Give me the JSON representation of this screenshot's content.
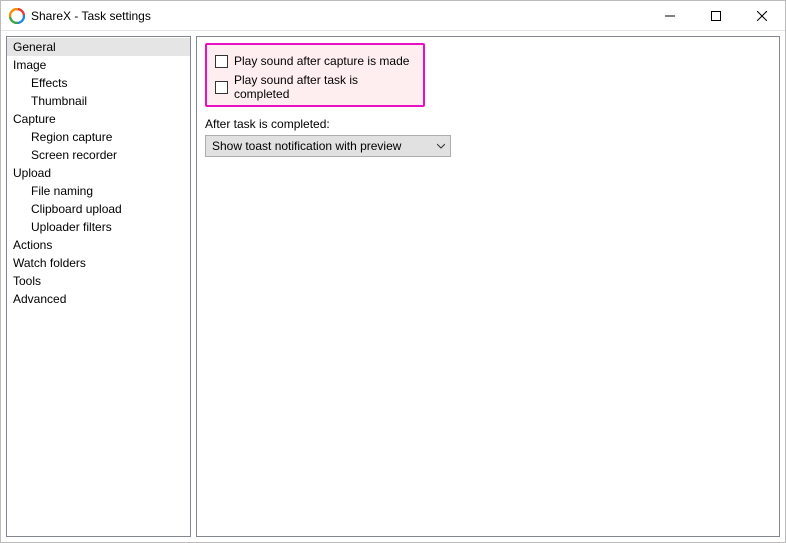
{
  "window": {
    "title": "ShareX - Task settings"
  },
  "sidebar": {
    "items": [
      {
        "label": "General",
        "level": 0,
        "selected": true
      },
      {
        "label": "Image",
        "level": 0,
        "selected": false
      },
      {
        "label": "Effects",
        "level": 1,
        "selected": false
      },
      {
        "label": "Thumbnail",
        "level": 1,
        "selected": false
      },
      {
        "label": "Capture",
        "level": 0,
        "selected": false
      },
      {
        "label": "Region capture",
        "level": 1,
        "selected": false
      },
      {
        "label": "Screen recorder",
        "level": 1,
        "selected": false
      },
      {
        "label": "Upload",
        "level": 0,
        "selected": false
      },
      {
        "label": "File naming",
        "level": 1,
        "selected": false
      },
      {
        "label": "Clipboard upload",
        "level": 1,
        "selected": false
      },
      {
        "label": "Uploader filters",
        "level": 1,
        "selected": false
      },
      {
        "label": "Actions",
        "level": 0,
        "selected": false
      },
      {
        "label": "Watch folders",
        "level": 0,
        "selected": false
      },
      {
        "label": "Tools",
        "level": 0,
        "selected": false
      },
      {
        "label": "Advanced",
        "level": 0,
        "selected": false
      }
    ]
  },
  "general": {
    "checkbox1_label": "Play sound after capture is made",
    "checkbox1_checked": false,
    "checkbox2_label": "Play sound after task is completed",
    "checkbox2_checked": false,
    "after_task_label": "After task is completed:",
    "after_task_selected": "Show toast notification with preview"
  }
}
